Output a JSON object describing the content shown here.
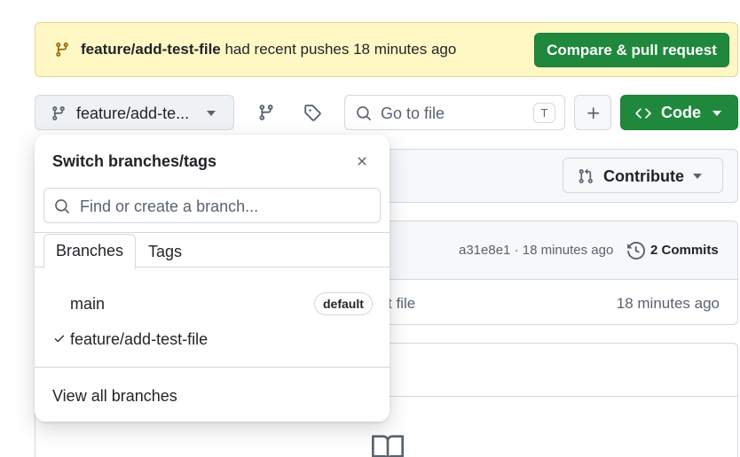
{
  "banner": {
    "branch": "feature/add-test-file",
    "message": " had recent pushes 18 minutes ago",
    "compare_button": "Compare & pull request",
    "icon": "git-branch-icon"
  },
  "toolbar": {
    "branch_label": "feature/add-te...",
    "go_to_file_placeholder": "Go to file",
    "go_to_file_shortcut": "T",
    "code_button": "Code",
    "contribute_button": "Contribute"
  },
  "commit_bar": {
    "meta": "a31e8e1 · 18 minutes ago",
    "commits_link": "2 Commits"
  },
  "file_row": {
    "partial_text": "t file",
    "time": "18 minutes ago"
  },
  "dropdown": {
    "title": "Switch branches/tags",
    "search_placeholder": "Find or create a branch...",
    "tabs": [
      {
        "label": "Branches",
        "active": true
      },
      {
        "label": "Tags",
        "active": false
      }
    ],
    "branches": [
      {
        "name": "main",
        "badge": "default",
        "selected": false
      },
      {
        "name": "feature/add-test-file",
        "badge": "",
        "selected": true
      }
    ],
    "view_all": "View all branches"
  },
  "colors": {
    "accent_green": "#1f883d",
    "banner_bg": "#fff8c5",
    "border": "#d1d9e0",
    "muted_text": "#59636e"
  }
}
